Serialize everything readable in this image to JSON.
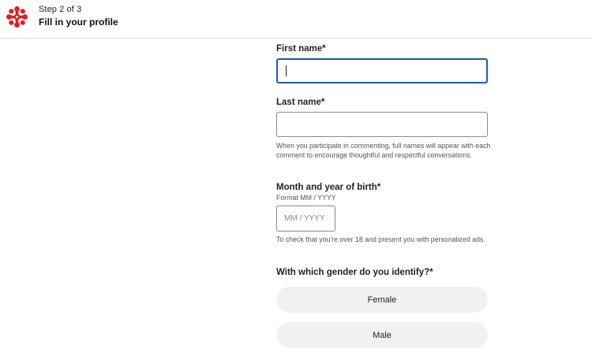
{
  "header": {
    "step": "Step 2 of 3",
    "title": "Fill in your profile",
    "logo_color": "#e31b23"
  },
  "form": {
    "first_name": {
      "label": "First name*",
      "value": ""
    },
    "last_name": {
      "label": "Last name*",
      "value": "",
      "help": "When you participate in commenting, full names will appear with each comment to encourage thoughtful and respectful conversations."
    },
    "birth": {
      "label": "Month and year of birth*",
      "format": "Format MM / YYYY",
      "placeholder": "MM / YYYY",
      "help": "To check that you're over 18 and present you with personalized ads."
    },
    "gender": {
      "label": "With which gender do you identify?*",
      "options": [
        "Female",
        "Male"
      ]
    }
  },
  "colors": {
    "focus_border": "#1e5aa8",
    "pill_bg": "#f1f1f0"
  }
}
